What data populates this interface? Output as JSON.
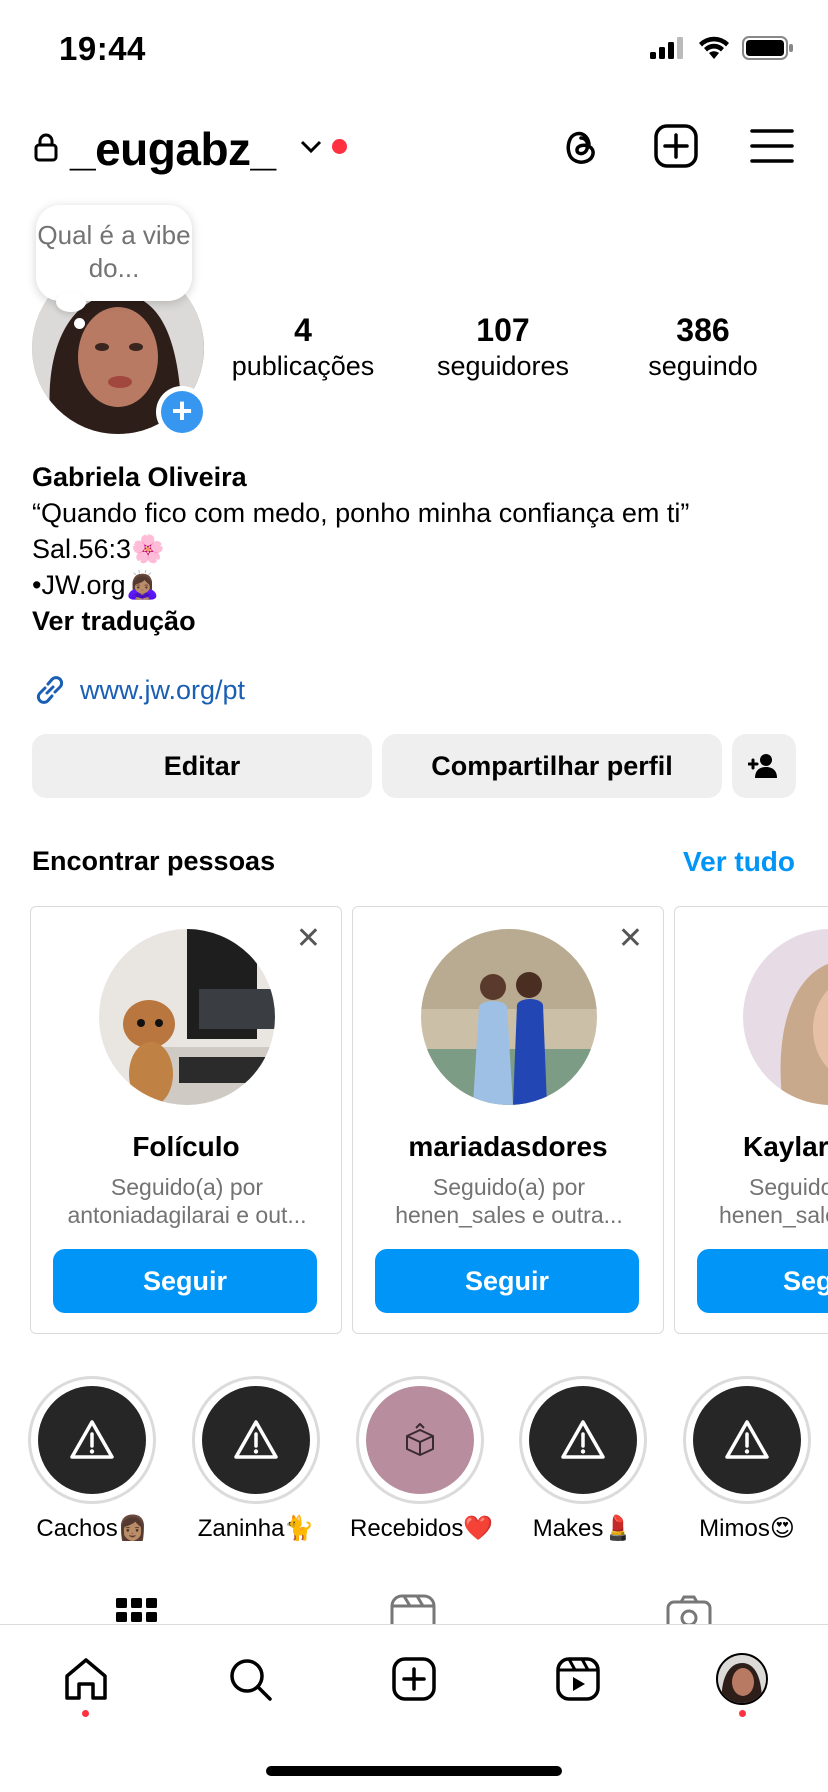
{
  "status_bar": {
    "time": "19:44"
  },
  "header": {
    "username": "_eugabz_"
  },
  "note": {
    "text": "Qual é a vibe do..."
  },
  "stats": [
    {
      "value": "4",
      "label": "publicações"
    },
    {
      "value": "107",
      "label": "seguidores"
    },
    {
      "value": "386",
      "label": "seguindo"
    }
  ],
  "bio": {
    "name": "Gabriela Oliveira",
    "line1": "“Quando fico com medo, ponho minha confiança em ti”",
    "line2": "Sal.56:3🌸",
    "line3": "•JW.org🙇🏽‍♀️",
    "translate": "Ver tradução",
    "link": "www.jw.org/pt"
  },
  "actions": {
    "edit": "Editar",
    "share": "Compartilhar perfil"
  },
  "discover": {
    "title": "Encontrar pessoas",
    "see_all": "Ver tudo",
    "cards": [
      {
        "name": "Folículo",
        "sub1": "Seguido(a) por",
        "sub2": "antoniadagilarai e out...",
        "follow": "Seguir"
      },
      {
        "name": "mariadasdores",
        "sub1": "Seguido(a) por",
        "sub2": "henen_sales e outra...",
        "follow": "Seguir"
      },
      {
        "name": "Kaylar",
        "sub1": "Seguido",
        "sub2": "henen_sale",
        "follow": "Seg"
      }
    ]
  },
  "highlights": [
    {
      "label": "Cachos👩🏽",
      "icon": "warning-icon"
    },
    {
      "label": "Zaninha🐈",
      "icon": "warning-icon"
    },
    {
      "label": "Recebidos❤️",
      "icon": "gift-box-icon"
    },
    {
      "label": "Makes💄",
      "icon": "warning-icon"
    },
    {
      "label": "Mimos😍",
      "icon": "warning-icon"
    }
  ],
  "colors": {
    "accent": "#0095f6",
    "notification": "#ff3040",
    "button_bg": "#efefef"
  }
}
